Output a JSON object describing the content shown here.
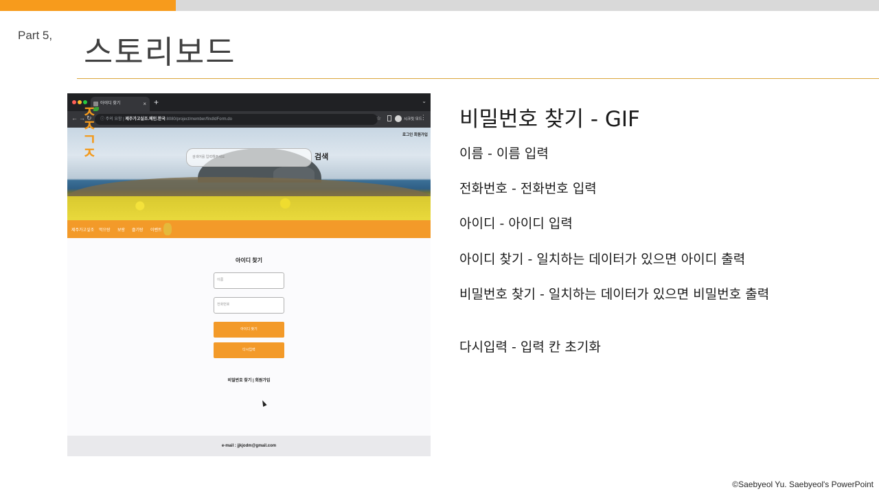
{
  "colors": {
    "accent": "#f79b1c",
    "rule": "#dba53a",
    "topbar": "#d9d9d9",
    "site_orange": "#f39a29"
  },
  "slide": {
    "part_label": "Part  5,",
    "title": "스토리보드",
    "desc_title": "비밀번호 찾기 - GIF",
    "desc_lines": [
      "이름 - 이름 입력",
      "전화번호 - 전화번호 입력",
      "아이디 - 아이디 입력",
      "아이디 찾기 - 일치하는 데이터가 있으면 아이디 출력",
      "비밀번호 찾기 - 일치하는 데이터가 있으면 비밀번호 출력",
      "다시입력 - 입력 칸 초기화"
    ],
    "copyright": "©Saebyeol Yu. Saebyeol's PowerPoint"
  },
  "screenshot": {
    "browser": {
      "tab_title": "아이디 찾기",
      "url_prefix": "ⓘ 주의 요함 |",
      "url_host": "제주가고싶조.메인.한국",
      "url_path": ":8080/project/member/findIdForm.do",
      "profile_label": "시크릿 모드",
      "icons": [
        "close-icon",
        "plus-icon",
        "back-arrow-icon",
        "forward-arrow-icon",
        "reload-icon",
        "star-icon",
        "more-icon"
      ]
    },
    "site": {
      "logo_text": "ㅈㅈ\nㄱㅈ",
      "login_links": "로그인  회원가입",
      "search_placeholder": "검색어를 입력해주세요",
      "search_button": "검색",
      "nav": [
        "제주가고싶조",
        "먹으랑",
        "보랑",
        "즐기랑",
        "이벤트"
      ],
      "form_title": "아이디 찾기",
      "name_placeholder": "이름",
      "phone_placeholder": "전화번호",
      "find_id_button": "아이디 찾기",
      "reset_button": "다시입력",
      "links": "비밀번호 찾기 | 회원가입",
      "footer": "e-mail : jjkjodm@gmail.com"
    }
  }
}
